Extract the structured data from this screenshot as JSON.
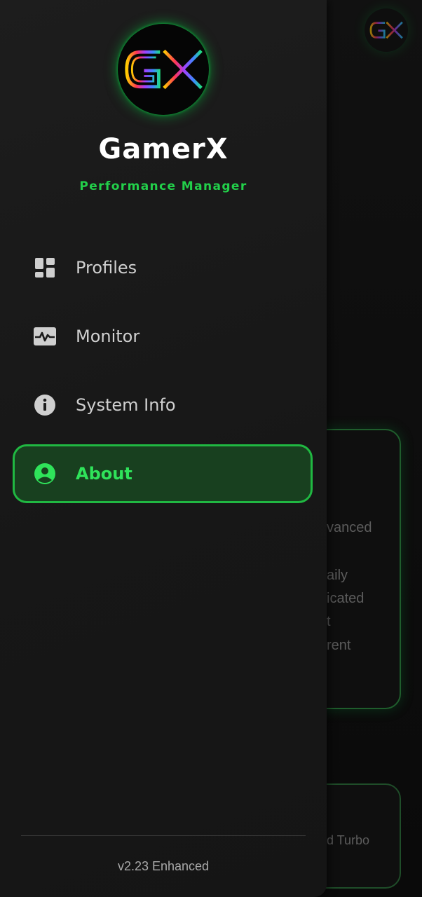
{
  "background": {
    "text_lines": [
      "vanced",
      "aily",
      "icated",
      "t",
      "rent"
    ],
    "bottom_card_text": "d Turbo"
  },
  "drawer": {
    "logo_icon": "gx-logo-icon",
    "app_name": "GamerX",
    "app_subtitle": "Performance Manager",
    "menu": [
      {
        "label": "Profiles",
        "icon": "dashboard-icon",
        "active": false
      },
      {
        "label": "Monitor",
        "icon": "monitor-heart-icon",
        "active": false
      },
      {
        "label": "System Info",
        "icon": "info-icon",
        "active": false
      },
      {
        "label": "About",
        "icon": "account-circle-icon",
        "active": true
      }
    ],
    "version": "v2.23 Enhanced"
  },
  "colors": {
    "accent": "#22d04a",
    "active_bg": "#18401f",
    "active_border": "#20b842",
    "drawer_bg": "#1a1a1a"
  }
}
